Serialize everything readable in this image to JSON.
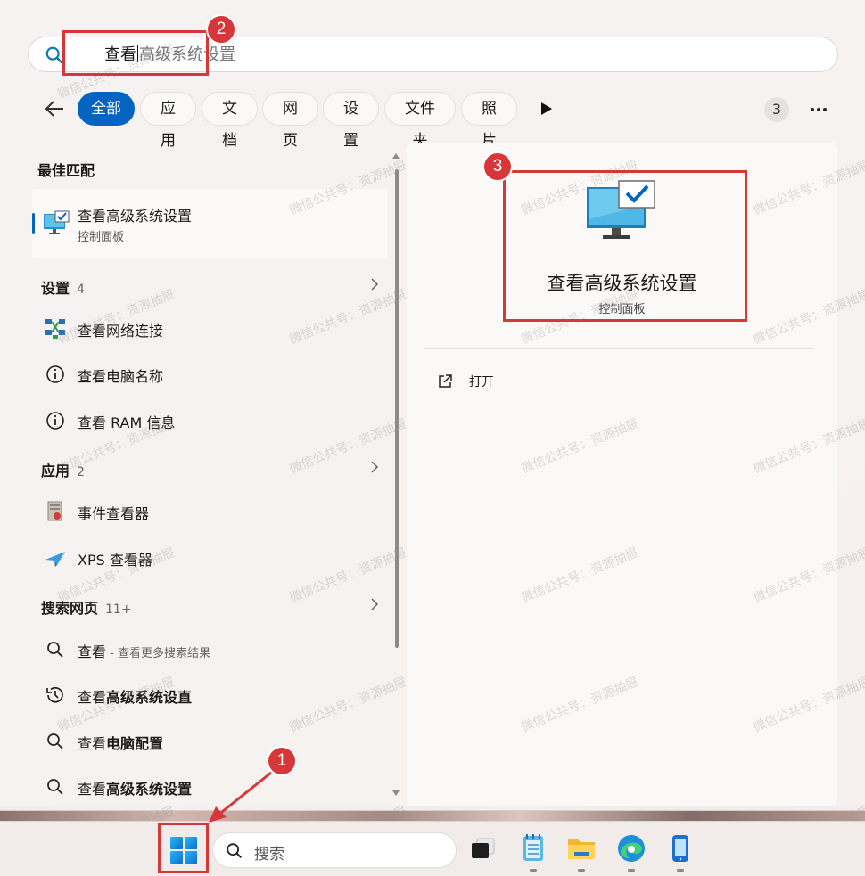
{
  "search": {
    "typed": "查看",
    "suggestion": "高级系统设置"
  },
  "filters": {
    "chips": [
      "全部",
      "应用",
      "文档",
      "网页",
      "设置",
      "文件夹",
      "照片"
    ],
    "result_count": "3"
  },
  "best_match": {
    "header": "最佳匹配",
    "title": "查看高级系统设置",
    "subtitle": "控制面板"
  },
  "settings_section": {
    "header": "设置",
    "count": "4",
    "items": [
      "查看网络连接",
      "查看电脑名称",
      "查看 RAM 信息"
    ]
  },
  "apps_section": {
    "header": "应用",
    "count": "2",
    "items": [
      "事件查看器",
      "XPS 查看器"
    ]
  },
  "web_section": {
    "header": "搜索网页",
    "count": "11+",
    "items": [
      {
        "prefix": "查看",
        "bold": "",
        "suffix": " - 查看更多搜索结果"
      },
      {
        "prefix": "查看",
        "bold": "高级系统设直",
        "suffix": ""
      },
      {
        "prefix": "查看",
        "bold": "电脑配置",
        "suffix": ""
      },
      {
        "prefix": "查看",
        "bold": "高级系统设置",
        "suffix": ""
      }
    ]
  },
  "preview": {
    "title": "查看高级系统设置",
    "subtitle": "控制面板",
    "open_label": "打开"
  },
  "annotations": [
    "1",
    "2",
    "3"
  ],
  "taskbar": {
    "search_placeholder": "搜索"
  },
  "watermark": "微信公共号：资源抽屉",
  "colors": {
    "accent": "#0563c1",
    "annotation": "#d8373a"
  }
}
